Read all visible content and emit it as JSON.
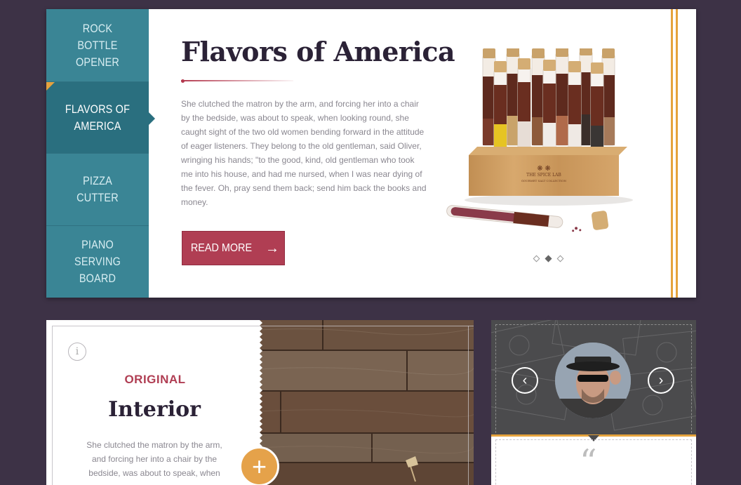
{
  "hero": {
    "tabs": [
      {
        "label": "Rock Bottle Opener"
      },
      {
        "label": "Flavors of America"
      },
      {
        "label": "Pizza Cutter"
      },
      {
        "label": "Piano Serving Board"
      }
    ],
    "active_tab": 1,
    "title": "Flavors of America",
    "body": "She clutched the matron by the arm, and forcing her into a chair by the bedside, was about to speak, when looking round, she caught sight of the two old women bending forward in the attitude of eager listeners. They belong to the old gentleman, said Oliver, wringing his hands; \"to the good, kind, old gentleman who took me into his house, and had me nursed, when I was near dying of the fever. Oh, pray send them back; send him back the books and money.",
    "read_more_label": "Read More",
    "arrow_icon": "→",
    "product_image": "spice-lab-salt-tubes",
    "product_labels": {
      "brand": "THE SPICE LAB",
      "sub": "GOURMET SALT COLLECTION"
    },
    "slider_dots": 3,
    "active_dot": 1,
    "colors": {
      "teal": "#3a8595",
      "teal_active": "#2a6f7f",
      "accent": "#b03e53",
      "gold": "#e5a33c"
    }
  },
  "interior_card": {
    "info_icon": "i",
    "kicker": "Original",
    "title": "Interior",
    "body": "She clutched the matron by the arm, and forcing her into a chair by the bedside, was about to speak, when",
    "plus_icon": "+"
  },
  "testimonial": {
    "prev_icon": "‹",
    "next_icon": "›",
    "quote_icon": "“"
  }
}
